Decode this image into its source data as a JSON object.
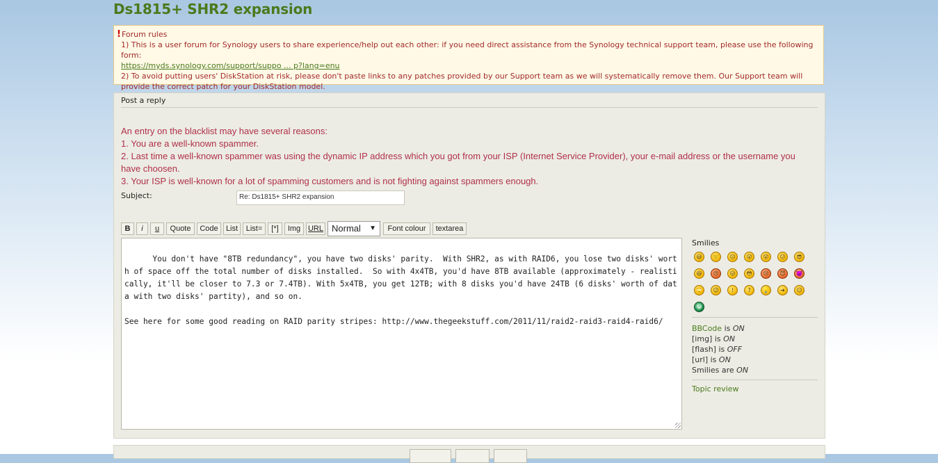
{
  "page": {
    "title": "Ds1815+ SHR2 expansion"
  },
  "forum_rules": {
    "heading": "Forum rules",
    "line1": "1) This is a user forum for Synology users to share experience/help out each other: if you need direct assistance from the Synology technical support team, please use the following form:",
    "link": "https://myds.synology.com/support/suppo ... p?lang=enu",
    "line2": "2) To avoid putting users' DiskStation at risk, please don't paste links to any patches provided by our Support team as we will systematically remove them. Our Support team will provide the correct patch for your DiskStation model."
  },
  "post": {
    "heading": "Post a reply",
    "blacklist": [
      "An entry on the blacklist may have several reasons:",
      "1. You are a well-known spammer.",
      "2. Last time a well-known spammer was using the dynamic IP address which you got from your ISP (Internet Service Provider), your e-mail address or the username you have choosen.",
      "3. Your ISP is well-known for a lot of spamming customers and is not fighting against spammers enough."
    ],
    "subject_label": "Subject:",
    "subject_value": "Re: Ds1815+ SHR2 expansion"
  },
  "toolbar": {
    "bold": "B",
    "italic": "i",
    "underline": "u",
    "quote": "Quote",
    "code": "Code",
    "list": "List",
    "list_ordered": "List=",
    "list_item": "[*]",
    "img": "Img",
    "url": "URL",
    "size_selected": "Normal",
    "font_colour": "Font colour",
    "textarea": "textarea"
  },
  "editor": {
    "text": "You don't have \"8TB redundancy\", you have two disks' parity.  With SHR2, as with RAID6, you lose two disks' worth of space off the total number of disks installed.  So with 4x4TB, you'd have 8TB available (approximately - realistically, it'll be closer to 7.3 or 7.4TB). With 5x4TB, you get 12TB; with 8 disks you'd have 24TB (6 disks' worth of data with two disks' partity), and so on.\n\nSee here for some good reading on RAID parity stripes: http://www.thegeekstuff.com/2011/11/raid2-raid3-raid4-raid6/"
  },
  "sidebar": {
    "smilies_title": "Smilies",
    "smilies": [
      {
        "name": "very-happy-smiley-icon",
        "glyph": "😃"
      },
      {
        "name": "smile-smiley-icon",
        "glyph": "🙂"
      },
      {
        "name": "sad-smiley-icon",
        "glyph": "☹"
      },
      {
        "name": "surprised-smiley-icon",
        "glyph": "😮"
      },
      {
        "name": "eek-smiley-icon",
        "glyph": "😲"
      },
      {
        "name": "confused-smiley-icon",
        "glyph": "😕"
      },
      {
        "name": "cool-smiley-icon",
        "glyph": "😎"
      },
      {
        "name": "laughing-smiley-icon",
        "glyph": "😆"
      },
      {
        "name": "mad-smiley-icon",
        "glyph": "😠"
      },
      {
        "name": "razz-smiley-icon",
        "glyph": "😛"
      },
      {
        "name": "embarrassed-smiley-icon",
        "glyph": "😳"
      },
      {
        "name": "crying-smiley-icon",
        "glyph": "😢"
      },
      {
        "name": "evil-smiley-icon",
        "glyph": "😈"
      },
      {
        "name": "twisted-evil-smiley-icon",
        "glyph": "👿"
      },
      {
        "name": "rolling-eyes-smiley-icon",
        "glyph": "🙄"
      },
      {
        "name": "wink-smiley-icon",
        "glyph": "😉"
      },
      {
        "name": "exclaim-smiley-icon",
        "glyph": "!"
      },
      {
        "name": "question-smiley-icon",
        "glyph": "?"
      },
      {
        "name": "idea-smiley-icon",
        "glyph": "💡"
      },
      {
        "name": "arrow-smiley-icon",
        "glyph": "➔"
      },
      {
        "name": "neutral-smiley-icon",
        "glyph": "😐"
      },
      {
        "name": "green-grin-smiley-icon",
        "glyph": "😁"
      }
    ],
    "options": {
      "bbcode_label": "BBCode",
      "bbcode_state": "ON",
      "img_label": "[img] is",
      "img_state": "ON",
      "flash_label": "[flash] is",
      "flash_state": "OFF",
      "url_label": "[url] is",
      "url_state": "ON",
      "smilies_label": "Smilies are",
      "smilies_state": "ON",
      "is_word": "is"
    },
    "topic_review": "Topic review"
  }
}
